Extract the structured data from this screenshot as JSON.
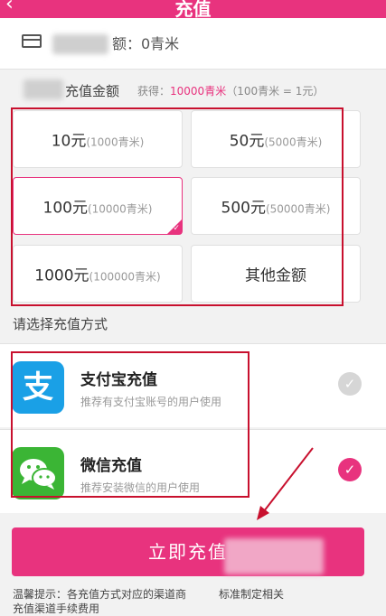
{
  "header": {
    "title": "充值",
    "back_icon": "back-arrow-icon"
  },
  "balance": {
    "label": "额：0青米",
    "icon": "card-icon"
  },
  "recharge": {
    "title": "充值金额",
    "note_prefix": "获得：",
    "note_value": "10000青米",
    "note_suffix": "（100青米 = 1元）",
    "options": [
      {
        "amount": "10元",
        "detail": "(1000青米)"
      },
      {
        "amount": "50元",
        "detail": "(5000青米)"
      },
      {
        "amount": "100元",
        "detail": "(10000青米)"
      },
      {
        "amount": "500元",
        "detail": "(50000青米)"
      },
      {
        "amount": "1000元",
        "detail": "(100000青米)"
      },
      {
        "amount": "其他金额",
        "detail": ""
      }
    ],
    "selected_index": 2
  },
  "payment": {
    "label": "请选择充值方式",
    "methods": [
      {
        "name": "支付宝充值",
        "desc": "推荐有支付宝账号的用户使用",
        "icon": "alipay-icon",
        "glyph": "支",
        "selected": false
      },
      {
        "name": "微信充值",
        "desc": "推荐安装微信的用户使用",
        "icon": "wechat-icon",
        "selected": true
      }
    ]
  },
  "submit": {
    "label": "立即充值"
  },
  "tip": {
    "line1": "温馨提示：各充值方式对应的渠道商",
    "line1_end": "标准制定相关",
    "line2": "充值渠道手续费用"
  },
  "colors": {
    "accent": "#e8337e",
    "annotation": "#c8102e",
    "alipay": "#1aa0e6",
    "wechat": "#3bb535"
  }
}
